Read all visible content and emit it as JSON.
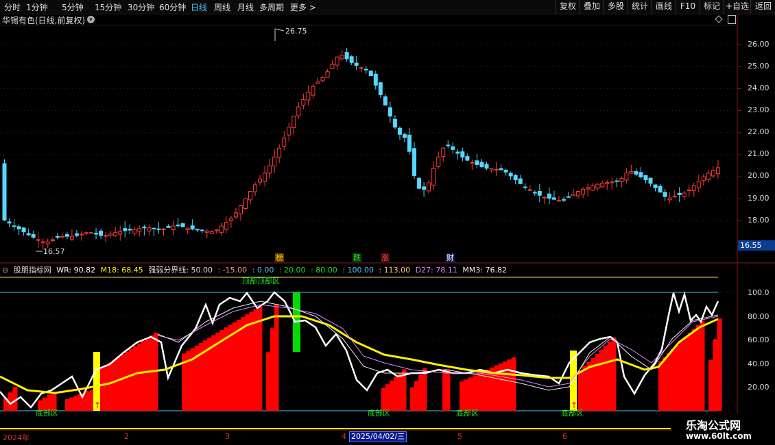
{
  "toolbar": {
    "periods": [
      {
        "label": "分时"
      },
      {
        "label": "1分钟"
      },
      {
        "label": "5分钟"
      },
      {
        "label": "15分钟"
      },
      {
        "label": "30分钟"
      },
      {
        "label": "60分钟"
      },
      {
        "label": "日线"
      },
      {
        "label": "周线"
      },
      {
        "label": "月线"
      },
      {
        "label": "多周期"
      },
      {
        "label": "更多 >"
      }
    ],
    "active": "日线",
    "right_buttons": [
      {
        "label": "复权"
      },
      {
        "label": "叠加"
      },
      {
        "label": "多股"
      },
      {
        "label": "统计"
      },
      {
        "label": "画线"
      },
      {
        "label": "F10"
      },
      {
        "label": "标记"
      },
      {
        "label": "+自选"
      },
      {
        "label": "返回"
      }
    ]
  },
  "stock": {
    "title": "华锡有色(日线,前复权)",
    "max_label": "26.75",
    "min_label": "16.57",
    "current_price": "16.55"
  },
  "price_axis": [
    "26.00",
    "25.00",
    "24.00",
    "23.00",
    "22.00",
    "21.00",
    "20.00",
    "19.00",
    "18.00"
  ],
  "event_tags": [
    {
      "text": "榜",
      "color": "#ffcc00",
      "bg": "#5a3a00"
    },
    {
      "text": "跌",
      "color": "#22dd22",
      "bg": "#0a3a0a"
    },
    {
      "text": "涨",
      "color": "#ff4444",
      "bg": "#3a0a0a"
    },
    {
      "text": "财",
      "color": "#ffffff",
      "bg": "#0a1a5a"
    }
  ],
  "indicator": {
    "name": "股朋指标网",
    "wr": "WR: 90.82",
    "m18": "M18: 68.45",
    "boundary": "强弱分界线: 50.00",
    "levels": [
      ": -15.00",
      ": 0.00",
      ": 20.00",
      ": 80.00",
      ": 100.00",
      ": 113.00"
    ],
    "d27": "D27: 78.11",
    "mm3": "MM3: 76.82",
    "top_zone": "顶部顶部区",
    "bottom_zone": "底部区",
    "axis": [
      "100.0",
      "80.00",
      "60.00",
      "40.00",
      "20.00"
    ]
  },
  "dates": {
    "year": "2024年",
    "m2": "2",
    "m3": "3",
    "m4": "4",
    "selected": "2025/04/02/三",
    "m5": "5",
    "m6": "6"
  },
  "watermark": {
    "line1": "乐淘公式网",
    "line2": "www.60lt.com"
  },
  "colors": {
    "up": "#ff3b3b",
    "down": "#54d8ff",
    "wr": "#ffffff",
    "m18": "#ffee00",
    "bar_red": "#ff0000",
    "bar_yellow": "#ffff00",
    "bar_green": "#00dd00"
  }
}
